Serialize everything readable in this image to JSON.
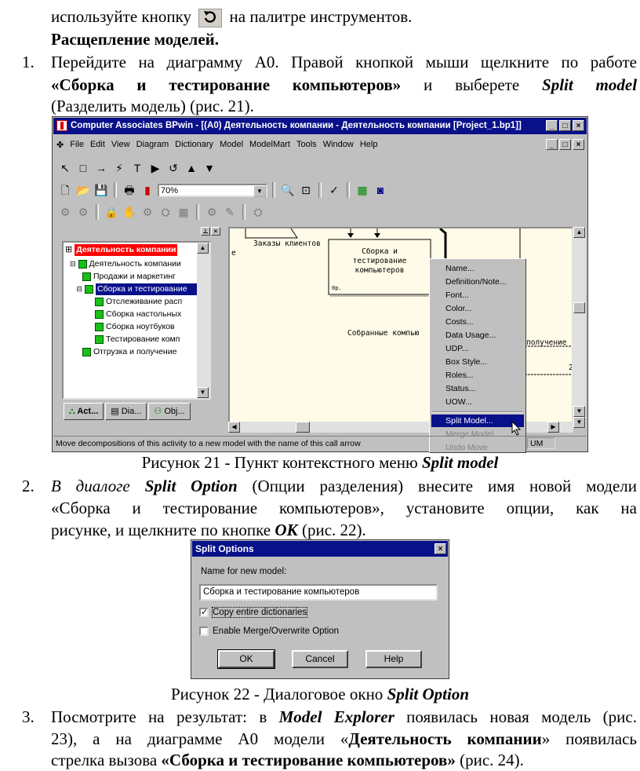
{
  "text": {
    "l1a": "используйте кнопку",
    "l1b": "на палитре инструментов.",
    "heading": "Расщепление моделей.",
    "s1_num": "1.",
    "s1_l1": "Перейдите на диаграмму A0. Правой кнопкой мыши щелкните по работе",
    "s1_l2_bold": "«Сборка и тестирование компьютеров»",
    "s1_l2_mid": "и выберете",
    "s1_l2_bi": "Split model",
    "s1_l3": "(Разделить модель) (рис. 21).",
    "fig21_prefix": "Рисунок 21 - Пункт контекстного меню",
    "fig21_bi": "Split model",
    "s2_num": "2.",
    "s2_l1_it": "В диалоге",
    "s2_l1_bi": "Split Option",
    "s2_l1_rest": "(Опции разделения) внесите имя новой модели",
    "s2_l2": "«Сборка и тестирование компьютеров», установите опции, как на",
    "s2_l3_a": "рисунке, и щелкните по кнопке",
    "s2_l3_bi": "ОК",
    "s2_l3_b": "(рис. 22).",
    "fig22_prefix": "Рисунок 22 - Диалоговое окно",
    "fig22_bi": "Split Option",
    "s3_num": "3.",
    "s3_l1_a": "Посмотрите на результат: в",
    "s3_l1_bi": "Model Explorer",
    "s3_l1_b": "появилась новая модель (рис.",
    "s3_l2_a": "23), а на диаграмме A0 модели «",
    "s3_l2_b": "Деятельность компании",
    "s3_l2_c": "» появилась",
    "s3_l3_a": "стрелка вызова",
    "s3_l3_b": "«Сборка и тестирование компьютеров»",
    "s3_l3_c": "(рис. 24)."
  },
  "bpwin": {
    "title": "Computer Associates BPwin - [(A0) Деятельность компании - Деятельность компании  [Project_1.bp1]]",
    "window_buttons": [
      "_",
      "□",
      "×"
    ],
    "menu": [
      "File",
      "Edit",
      "View",
      "Diagram",
      "Dictionary",
      "Model",
      "ModelMart",
      "Tools",
      "Window",
      "Help"
    ],
    "zoom": "70%",
    "tree": {
      "root": "Деятельность компании",
      "items": [
        "Деятельность компании",
        "Продажи и маркетинг",
        "Сборка и тестирование",
        "Отслеживание расп",
        "Сборка настольных",
        "Сборка ноутбуков",
        "Тестирование комп",
        "Отгрузка и получение"
      ]
    },
    "tabs": [
      "Act...",
      "Dia...",
      "Obj..."
    ],
    "diagram": {
      "arrow_orders": "Заказы клиентов",
      "box_l1": "Сборка и",
      "box_l2": "тестирование",
      "box_l3": "компьютеров",
      "box_corner": "0р.",
      "arrow_assembled": "Собранные компью",
      "arrow_receive": "получение",
      "side_mark": "е",
      "num": "2"
    },
    "context_menu": [
      "Name...",
      "Definition/Note...",
      "Font...",
      "Color...",
      "Costs...",
      "Data Usage...",
      "UDP...",
      "Box Style...",
      "Roles...",
      "Status...",
      "UOW...",
      "Split Model...",
      "Merge Model...",
      "Undo Move"
    ],
    "status_text": "Move decompositions of this activity to a new model with the name of this call arrow",
    "status_um": "UM"
  },
  "dialog": {
    "title": "Split Options",
    "label": "Name for new model:",
    "value": "Сборка и тестирование компьютеров",
    "opt1": "Copy entire dictionaries",
    "opt1_checked": "✓",
    "opt2": "Enable Merge/Overwrite Option",
    "ok": "OK",
    "cancel": "Cancel",
    "help": "Help",
    "close": "×"
  }
}
